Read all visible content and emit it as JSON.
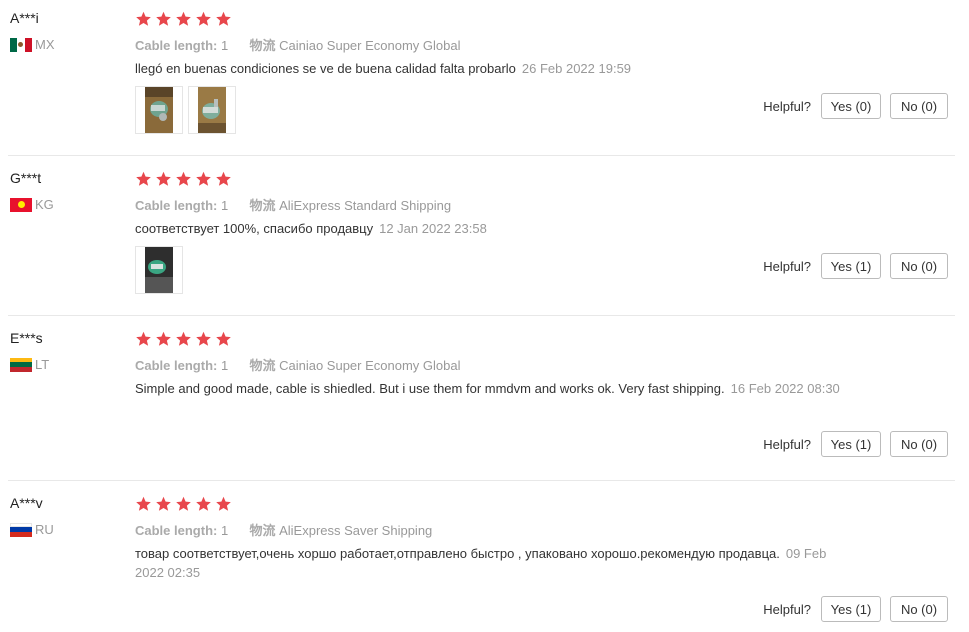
{
  "labels": {
    "cable_length_label": "Cable length:",
    "logistics_label": "物流",
    "helpful_label": "Helpful?"
  },
  "colors": {
    "star": "#e8474c"
  },
  "reviews": [
    {
      "user": "A***i",
      "country": "MX",
      "rating": 5,
      "cable_length": "1",
      "shipping": "Cainiao Super Economy Global",
      "text": "llegó en buenas condiciones se ve de buena calidad falta probarlo",
      "date": "26 Feb 2022 19:59",
      "yes": "Yes (0)",
      "no": "No (0)"
    },
    {
      "user": "G***t",
      "country": "KG",
      "rating": 5,
      "cable_length": "1",
      "shipping": "AliExpress Standard Shipping",
      "text": "соответствует 100%, спасибо продавцу",
      "date": "12 Jan 2022 23:58",
      "yes": "Yes (1)",
      "no": "No (0)"
    },
    {
      "user": "E***s",
      "country": "LT",
      "rating": 5,
      "cable_length": "1",
      "shipping": "Cainiao Super Economy Global",
      "text": "Simple and good made, cable is shiedled. But i use them for mmdvm and works ok. Very fast shipping.",
      "date": "16 Feb 2022 08:30",
      "yes": "Yes (1)",
      "no": "No (0)"
    },
    {
      "user": "A***v",
      "country": "RU",
      "rating": 5,
      "cable_length": "1",
      "shipping": "AliExpress Saver Shipping",
      "text": "товар соответствует,очень хоршо работает,отправлено быстро , упаковано хорошо.рекомендую продавца.",
      "date": "09 Feb 2022 02:35",
      "yes": "Yes (1)",
      "no": "No (0)"
    }
  ]
}
